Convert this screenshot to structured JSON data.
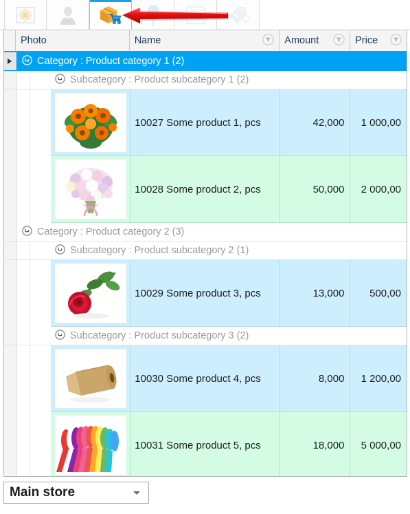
{
  "window": {
    "accent_blue": "#1c9fe3",
    "selected_row_blue": "#00a2f3",
    "row_blue": "#cdeefc",
    "row_green": "#d4fce4",
    "annotation_color": "#e51b1b"
  },
  "tabs": [
    {
      "icon": "picture-icon",
      "state": "inactive"
    },
    {
      "icon": "person-icon",
      "state": "inactive"
    },
    {
      "icon": "product-cart-icon",
      "state": "active"
    },
    {
      "icon": "balloon-icon",
      "state": "faded"
    },
    {
      "icon": "document-icon",
      "state": "faded"
    },
    {
      "icon": "price-tag-icon",
      "state": "faded"
    }
  ],
  "annotation": {
    "type": "left-arrow",
    "label": "red-arrow-pointing-to-active-tab"
  },
  "grid": {
    "columns": [
      {
        "key": "photo",
        "label": "Photo",
        "filter": false
      },
      {
        "key": "name",
        "label": "Name",
        "filter": true
      },
      {
        "key": "amount",
        "label": "Amount",
        "filter": true
      },
      {
        "key": "price",
        "label": "Price",
        "filter": true
      }
    ],
    "groups": [
      {
        "level": 1,
        "label": "Category : Product category 1 (2)",
        "selected": true,
        "subgroups": [
          {
            "level": 2,
            "label": "Subcategory : Product subcategory 1 (2)",
            "rows": [
              {
                "name": "10027 Some product 1, pcs",
                "amount": "42,000",
                "price": "1 000,00",
                "tone": "blue",
                "photo": "orange-bouquet-photo"
              },
              {
                "name": "10028 Some product 2, pcs",
                "amount": "50,000",
                "price": "2 000,00",
                "tone": "green",
                "photo": "pink-bouquet-photo"
              }
            ]
          }
        ]
      },
      {
        "level": 1,
        "label": "Category : Product category 2 (3)",
        "selected": false,
        "subgroups": [
          {
            "level": 2,
            "label": "Subcategory : Product subcategory 2 (1)",
            "rows": [
              {
                "name": "10029 Some product 3, pcs",
                "amount": "13,000",
                "price": "500,00",
                "tone": "blue",
                "photo": "red-rose-photo"
              }
            ]
          },
          {
            "level": 2,
            "label": "Subcategory : Product subcategory 3 (2)",
            "rows": [
              {
                "name": "10030 Some product 4, pcs",
                "amount": "8,000",
                "price": "1 200,00",
                "tone": "blue",
                "photo": "kraft-paper-roll-photo"
              },
              {
                "name": "10031 Some product 5, pcs",
                "amount": "18,000",
                "price": "5 000,00",
                "tone": "green",
                "photo": "colored-ribbons-photo"
              }
            ]
          }
        ]
      }
    ]
  },
  "footer": {
    "store_select": {
      "value": "Main store",
      "icon": "chevron-down-icon"
    }
  }
}
